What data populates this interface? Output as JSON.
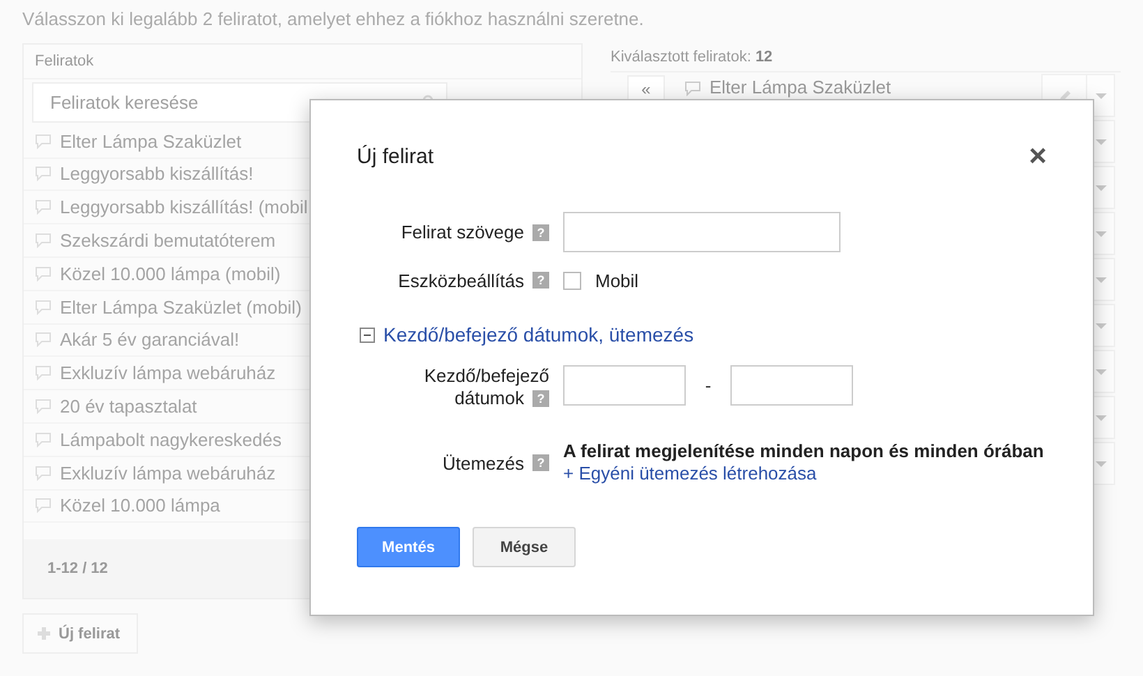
{
  "intro": "Válasszon ki legalább 2 feliratot, amelyet ehhez a fiókhoz használni szeretne.",
  "labels_panel": {
    "heading": "Feliratok",
    "search": {
      "placeholder": "Feliratok keresése"
    },
    "items": [
      "Elter Lámpa Szaküzlet",
      "Leggyorsabb kiszállítás!",
      "Leggyorsabb kiszállítás! (mobil",
      "Szekszárdi bemutatóterem",
      "Közel 10.000 lámpa (mobil)",
      "Elter Lámpa Szaküzlet (mobil)",
      "Akár 5 év garanciával!",
      "Exkluzív lámpa webáruház",
      "20 év tapasztalat",
      "Lámpabolt nagykereskedés",
      "Exkluzív lámpa webáruház",
      "Közel 10.000 lámpa"
    ],
    "pager": "1-12 / 12"
  },
  "new_label_button": "Új felirat",
  "selected_panel": {
    "heading": "Kiválasztott feliratok:",
    "count": "12",
    "remove_button": "«",
    "rows": [
      {
        "kind": "full",
        "text": "Elter Lámpa Szaküzlet"
      },
      {
        "kind": "covered"
      },
      {
        "kind": "covered"
      },
      {
        "kind": "covered"
      },
      {
        "kind": "covered"
      },
      {
        "kind": "covered"
      },
      {
        "kind": "covered"
      },
      {
        "kind": "covered"
      },
      {
        "kind": "covered"
      }
    ]
  },
  "dialog": {
    "title": "Új felirat",
    "close": "×",
    "help_mark": "?",
    "fields": [
      {
        "kind": "text",
        "label": "Felirat szövege"
      },
      {
        "kind": "checkbox",
        "label": "Eszközbeállítás",
        "option": "Mobil",
        "checked": false
      }
    ],
    "section": {
      "title": "Kezdő/befejező dátumok, ütemezés",
      "expanded": true
    },
    "dates": {
      "label_line1": "Kezdő/befejező",
      "label_line2": "dátumok",
      "separator": "-"
    },
    "schedule": {
      "label": "Ütemezés",
      "summary": "A felirat megjelenítése minden napon és minden órában",
      "link": "+ Egyéni ütemezés létrehozása"
    },
    "buttons": [
      {
        "kind": "primary",
        "label": "Mentés"
      },
      {
        "kind": "secondary",
        "label": "Mégse"
      }
    ]
  }
}
